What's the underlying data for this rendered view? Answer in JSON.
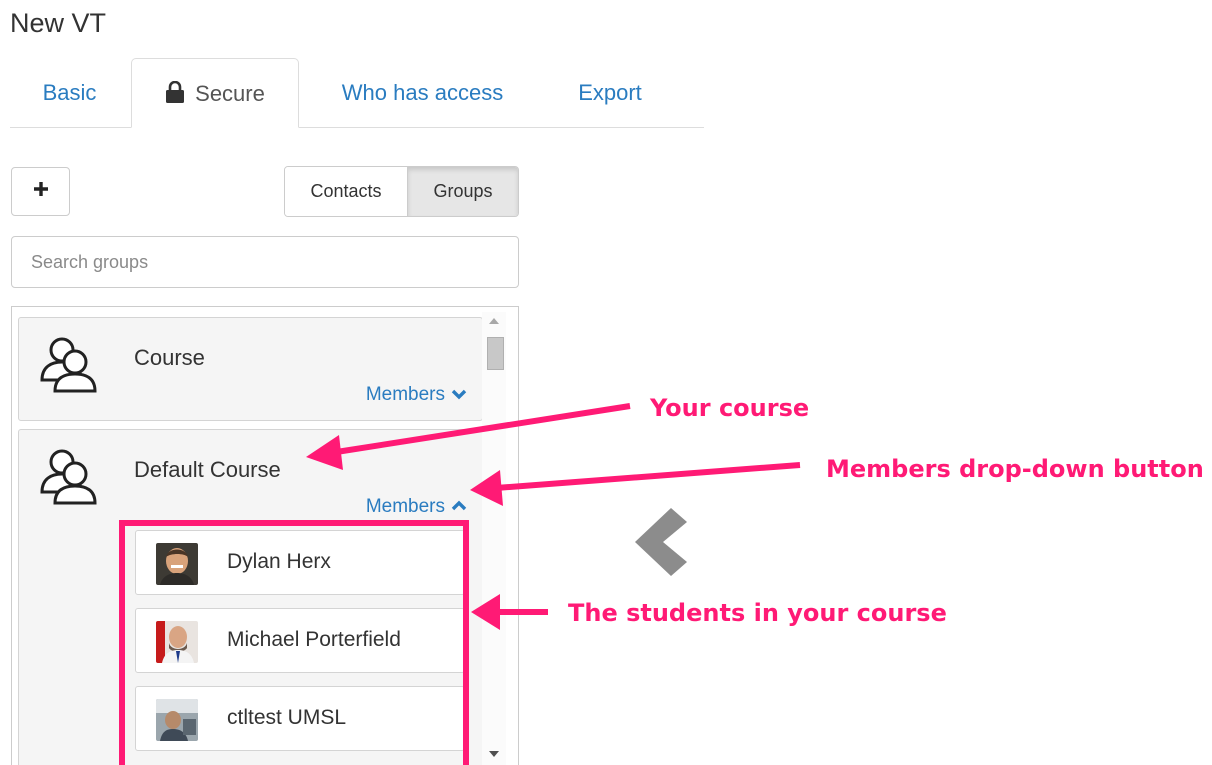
{
  "page": {
    "title": "New VT"
  },
  "tabs": [
    {
      "label": "Basic",
      "active": false
    },
    {
      "label": "Secure",
      "active": true,
      "icon": "lock-icon"
    },
    {
      "label": "Who has access",
      "active": false
    },
    {
      "label": "Export",
      "active": false
    }
  ],
  "toolbar": {
    "add_icon": "plus-icon",
    "toggle": {
      "contacts_label": "Contacts",
      "groups_label": "Groups",
      "selected": "Groups"
    }
  },
  "search": {
    "placeholder": "Search groups",
    "value": ""
  },
  "groups": [
    {
      "name": "Course",
      "members_label": "Members",
      "expanded": false,
      "chevron": "chevron-down-icon"
    },
    {
      "name": "Default Course",
      "members_label": "Members",
      "expanded": true,
      "chevron": "chevron-up-icon",
      "members": [
        {
          "name": "Dylan Herx",
          "avatar": "user-photo"
        },
        {
          "name": "Michael Porterfield",
          "avatar": "user-photo"
        },
        {
          "name": "ctltest UMSL",
          "avatar": "user-photo"
        }
      ]
    }
  ],
  "panel": {
    "collapse_icon": "chevron-left-icon"
  },
  "annotations": {
    "your_course": "Your course",
    "members_dropdown": "Members drop-down button",
    "students": "The students in your course",
    "color": "#ff1a75"
  },
  "colors": {
    "link": "#2a7cc0",
    "annotation": "#ff1a75"
  }
}
